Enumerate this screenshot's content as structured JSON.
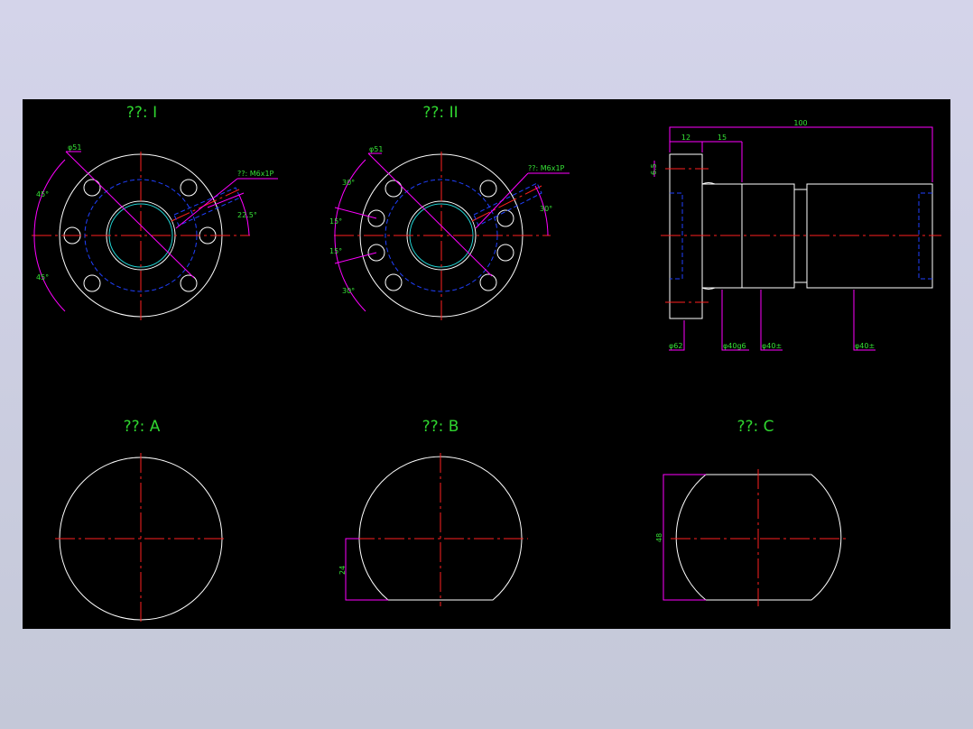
{
  "titles": {
    "view_i": "??: I",
    "view_ii": "??: II",
    "view_a": "??: A",
    "view_b": "??: B",
    "view_c": "??: C"
  },
  "view_i": {
    "bolt_circle": "φ51",
    "thread": "??: M6x1P",
    "angle_right": "22.5°",
    "angle_top": "45°",
    "angle_bottom": "45°"
  },
  "view_ii": {
    "bolt_circle": "φ51",
    "thread": "??: M6x1P",
    "angle_right": "30°",
    "angle_a": "30°",
    "angle_b": "15°",
    "angle_c": "15°",
    "angle_d": "30°"
  },
  "side_view": {
    "length_total": "100",
    "length_flange": "12",
    "length_pilot": "15",
    "offset": "6.5",
    "dia_flange": "φ62",
    "dia_pilot": "φ40g6",
    "dia_body_1": "φ40±",
    "dia_body_2": "φ40±"
  },
  "view_b": {
    "height": "24"
  },
  "view_c": {
    "width": "48"
  },
  "colors": {
    "background": "#000000",
    "outline": "#ffffff",
    "centerline": "#ff2020",
    "dimension": "#ff00ff",
    "hidden": "#2040ff",
    "text": "#36e036"
  }
}
